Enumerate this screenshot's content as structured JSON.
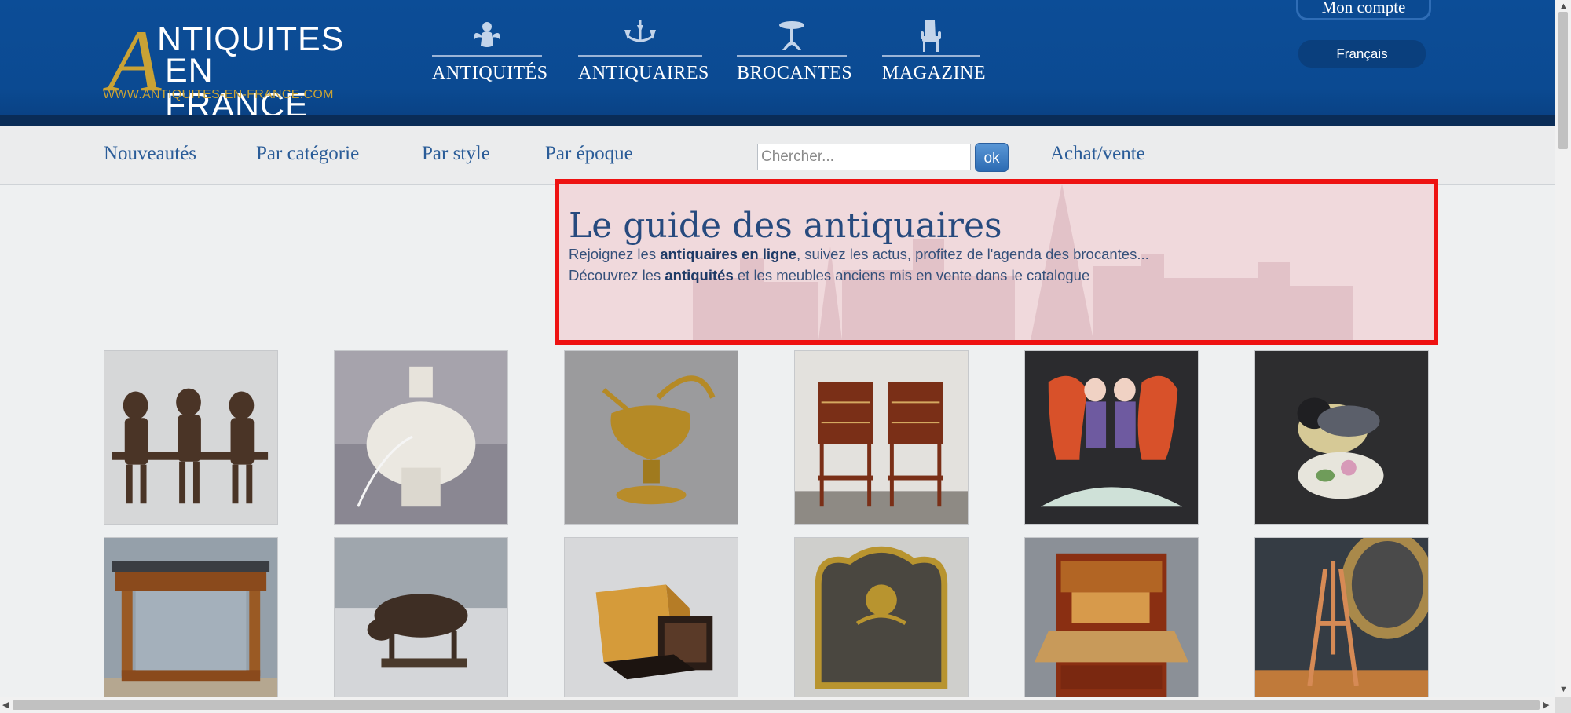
{
  "header": {
    "logo": {
      "initial": "A",
      "line1": "NTIQUITES",
      "line2": "EN FRANCE",
      "url": "WWW.ANTIQUITES-EN-FRANCE.COM"
    },
    "nav": [
      {
        "label": "ANTIQUITÉS",
        "icon": "cherub-icon"
      },
      {
        "label": "ANTIQUAIRES",
        "icon": "chandelier-icon"
      },
      {
        "label": "BROCANTES",
        "icon": "gueridon-table-icon"
      },
      {
        "label": "MAGAZINE",
        "icon": "armchair-icon"
      }
    ],
    "account_label": "Mon compte",
    "language": "Français"
  },
  "subnav": {
    "links": [
      "Nouveautés",
      "Par catégorie",
      "Par style",
      "Par époque"
    ],
    "search_placeholder": "Chercher...",
    "ok_label": "ok",
    "achat_label": "Achat/vente"
  },
  "guide": {
    "title": "Le guide des antiquaires",
    "line1_pre": "Rejoignez les ",
    "line1_bold": "antiquaires en ligne",
    "line1_post": ", suivez les actus, profitez de l'agenda des brocantes...",
    "line2_pre": "Découvrez les ",
    "line2_bold": "antiquités",
    "line2_post": " et les meubles anciens mis en vente dans le catalogue"
  },
  "products": [
    {
      "name": "bronze-figures-bench"
    },
    {
      "name": "crackle-ceramic-lamp"
    },
    {
      "name": "gilt-bronze-ewer"
    },
    {
      "name": "pair-nightstands"
    },
    {
      "name": "porcelain-figure-vases"
    },
    {
      "name": "porcelain-bird"
    },
    {
      "name": "marble-console-table"
    },
    {
      "name": "bronze-bull-sculpture"
    },
    {
      "name": "wooden-boxes"
    },
    {
      "name": "gilt-fire-screen"
    },
    {
      "name": "secretary-desk"
    },
    {
      "name": "wooden-easel"
    }
  ],
  "colors": {
    "header_blue": "#0b4a92",
    "gold": "#c9a235",
    "link_blue": "#2a5c98",
    "highlight_red": "#ee1212"
  }
}
